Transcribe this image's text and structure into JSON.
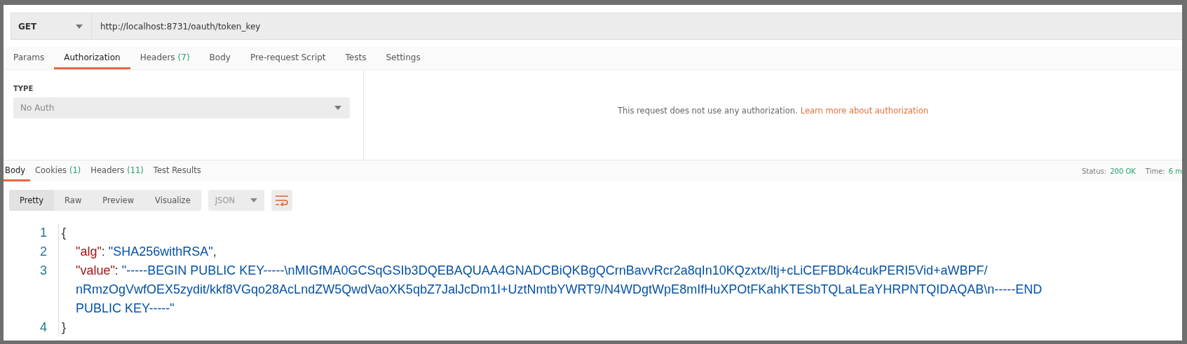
{
  "request": {
    "method": "GET",
    "url": "http://localhost:8731/oauth/token_key"
  },
  "request_tabs": [
    {
      "label": "Params",
      "selected": false
    },
    {
      "label": "Authorization",
      "selected": true
    },
    {
      "label": "Headers",
      "count": "(7)",
      "selected": false
    },
    {
      "label": "Body",
      "selected": false
    },
    {
      "label": "Pre-request Script",
      "selected": false
    },
    {
      "label": "Tests",
      "selected": false
    },
    {
      "label": "Settings",
      "selected": false
    }
  ],
  "auth": {
    "type_label": "TYPE",
    "type_value": "No Auth",
    "message": "This request does not use any authorization.",
    "link": "Learn more about authorization"
  },
  "response_tabs": [
    {
      "label": "Body",
      "selected": true
    },
    {
      "label": "Cookies",
      "count": "(1)",
      "selected": false
    },
    {
      "label": "Headers",
      "count": "(11)",
      "selected": false
    },
    {
      "label": "Test Results",
      "selected": false
    }
  ],
  "status": {
    "status_label": "Status:",
    "status_value": "200 OK",
    "time_label": "Time:",
    "time_value": "6 m"
  },
  "view_modes": [
    {
      "label": "Pretty",
      "selected": true
    },
    {
      "label": "Raw",
      "selected": false
    },
    {
      "label": "Preview",
      "selected": false
    },
    {
      "label": "Visualize",
      "selected": false
    }
  ],
  "format": "JSON",
  "code_lines": [
    {
      "number": "1",
      "kind": "open",
      "text": "{"
    },
    {
      "number": "2",
      "kind": "pair",
      "key": "\"alg\"",
      "sep": ":",
      "value": "\"SHA256withRSA\"",
      "trail": ","
    },
    {
      "number": "3",
      "kind": "pair",
      "key": "\"value\"",
      "sep": ":",
      "value": "\"-----BEGIN PUBLIC KEY-----\\nMIGfMA0GCSqGSIb3DQEBAQUAA4GNADCBiQKBgQCrnBavvRcr2a8qIn10KQzxtx/ltj+cLiCEFBDk4cukPERI5Vid+aWBPF/ nRmzOgVwfOEX5zydit/kkf8VGqo28AcLndZW5QwdVaoXK5qbZ7JalJcDm1I+UztNmtbYWRT9/N4WDgtWpE8mIfHuXPOtFKahKTESbTQLaLEaYHRPNTQIDAQAB\\n-----END PUBLIC KEY-----\""
    },
    {
      "number": "4",
      "kind": "close",
      "text": "}"
    }
  ]
}
